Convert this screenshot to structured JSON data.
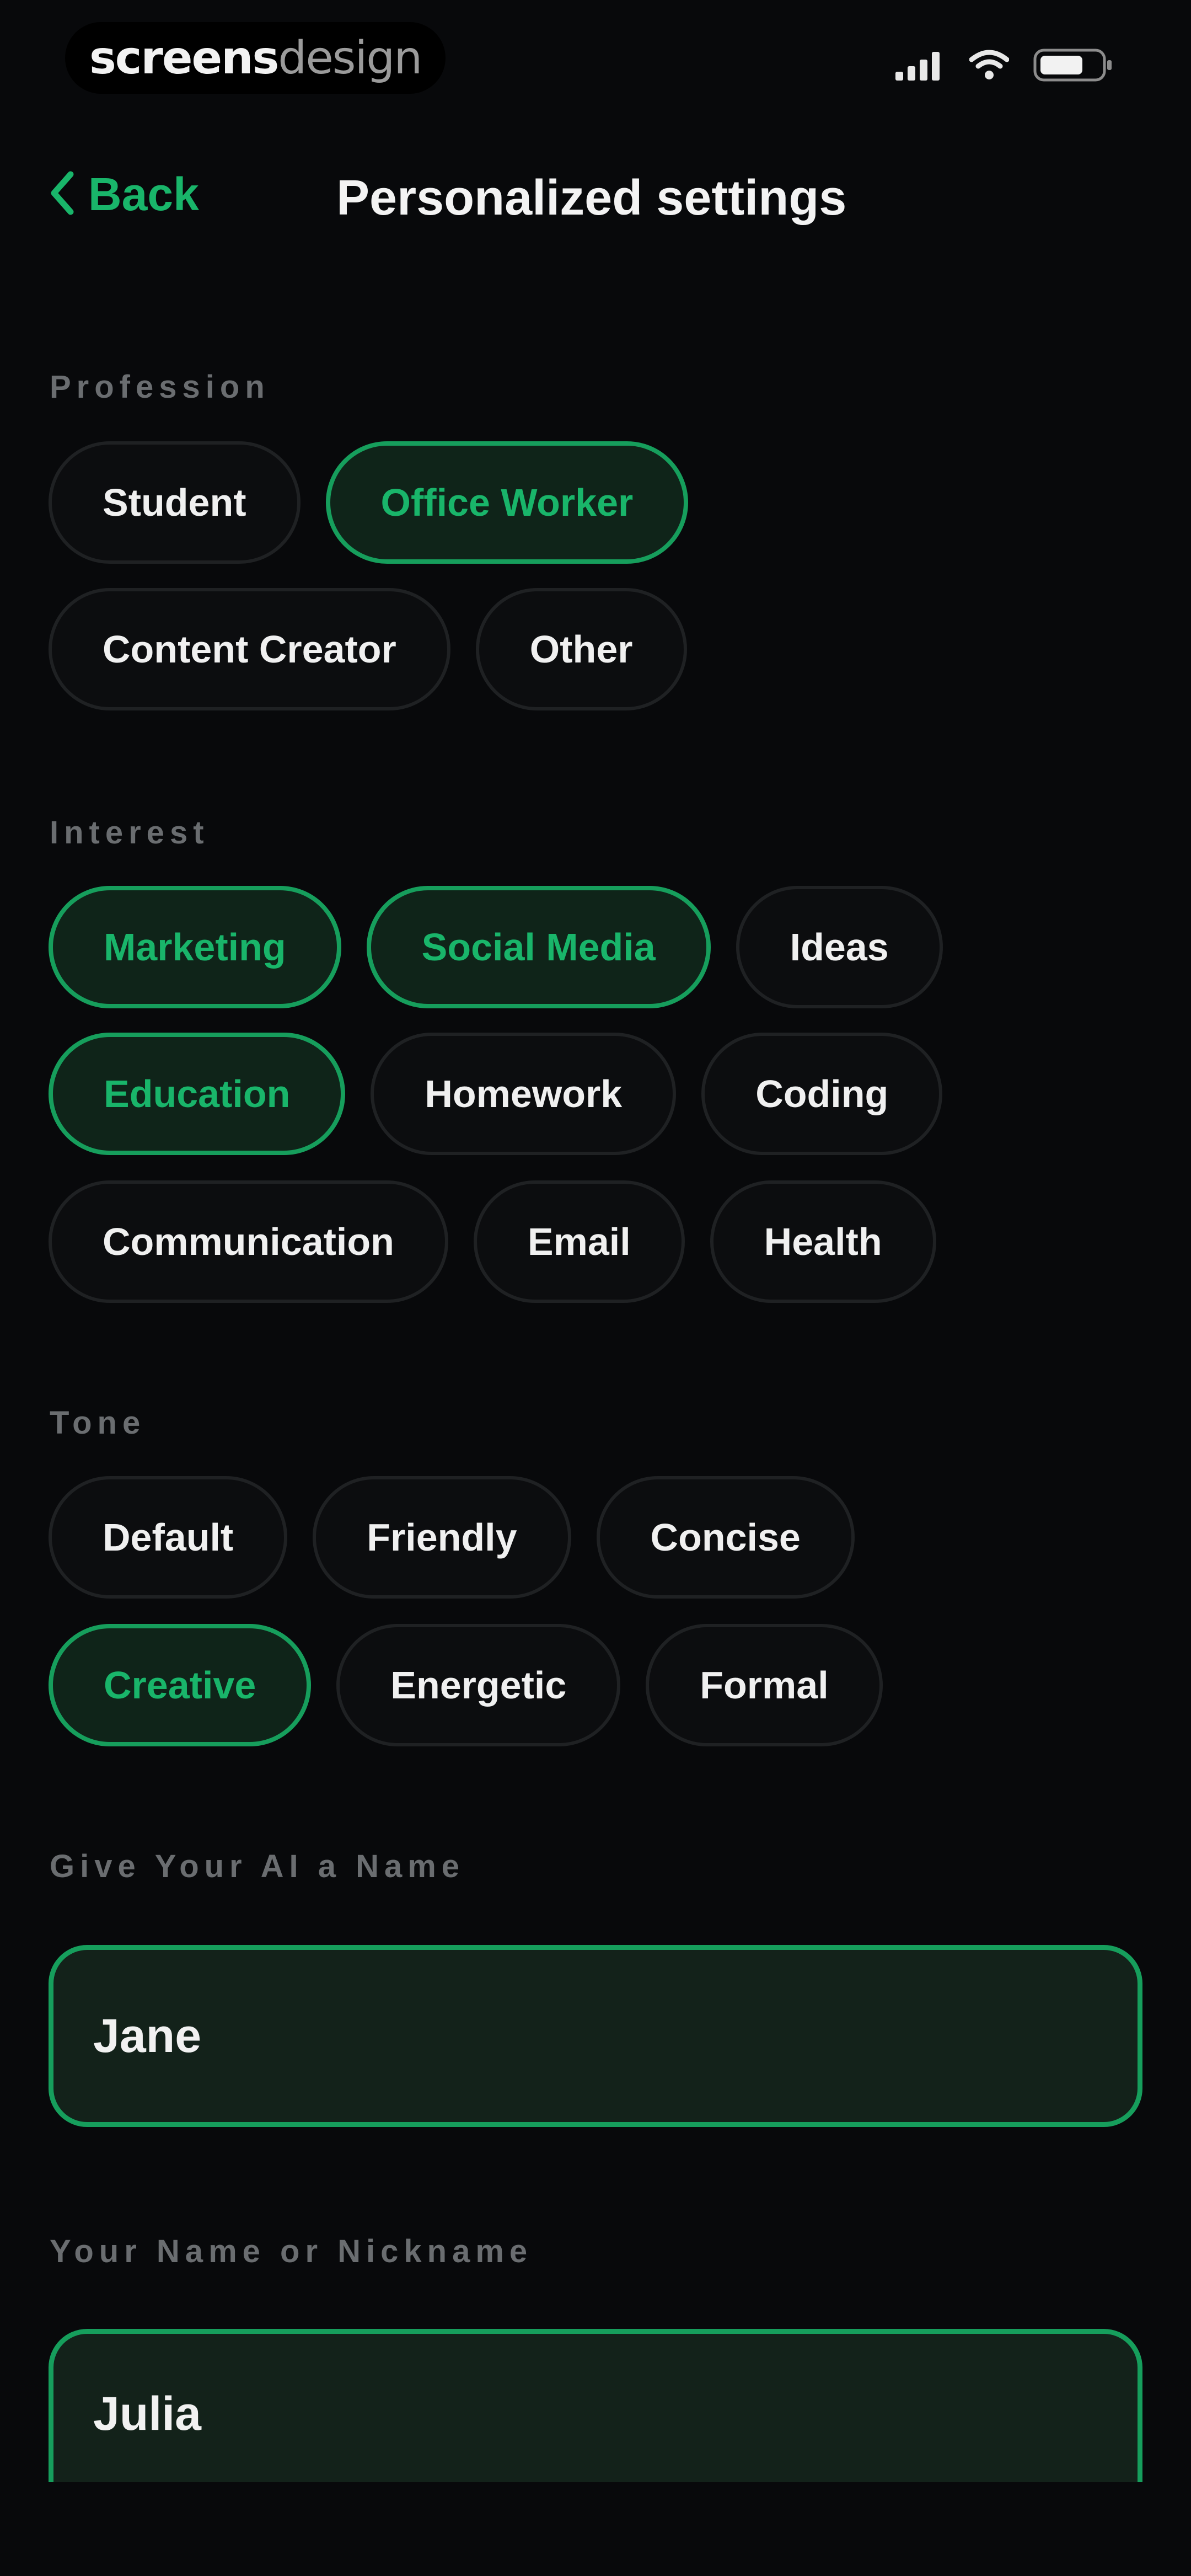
{
  "status_bar": {
    "watermark_bold": "screens",
    "watermark_light": "design",
    "icons": [
      "cellular-signal-icon",
      "wifi-icon",
      "battery-icon"
    ]
  },
  "nav": {
    "back_label": "Back",
    "title": "Personalized settings"
  },
  "profession": {
    "label": "Profession",
    "options": [
      {
        "label": "Student",
        "selected": false
      },
      {
        "label": "Office Worker",
        "selected": true
      },
      {
        "label": "Content Creator",
        "selected": false
      },
      {
        "label": "Other",
        "selected": false
      }
    ]
  },
  "interest": {
    "label": "Interest",
    "options": [
      {
        "label": "Marketing",
        "selected": true
      },
      {
        "label": "Social Media",
        "selected": true
      },
      {
        "label": "Ideas",
        "selected": false
      },
      {
        "label": "Education",
        "selected": true
      },
      {
        "label": "Homework",
        "selected": false
      },
      {
        "label": "Coding",
        "selected": false
      },
      {
        "label": "Communication",
        "selected": false
      },
      {
        "label": "Email",
        "selected": false
      },
      {
        "label": "Health",
        "selected": false
      }
    ]
  },
  "tone": {
    "label": "Tone",
    "options": [
      {
        "label": "Default",
        "selected": false
      },
      {
        "label": "Friendly",
        "selected": false
      },
      {
        "label": "Concise",
        "selected": false
      },
      {
        "label": "Creative",
        "selected": true
      },
      {
        "label": "Energetic",
        "selected": false
      },
      {
        "label": "Formal",
        "selected": false
      }
    ]
  },
  "ai_name": {
    "label": "Give Your AI a Name",
    "value": "Jane"
  },
  "user_name": {
    "label": "Your Name or Nickname",
    "value": "Julia"
  },
  "colors": {
    "accent": "#19b56a",
    "background": "#08090b",
    "selected_fill": "#0f2419"
  }
}
